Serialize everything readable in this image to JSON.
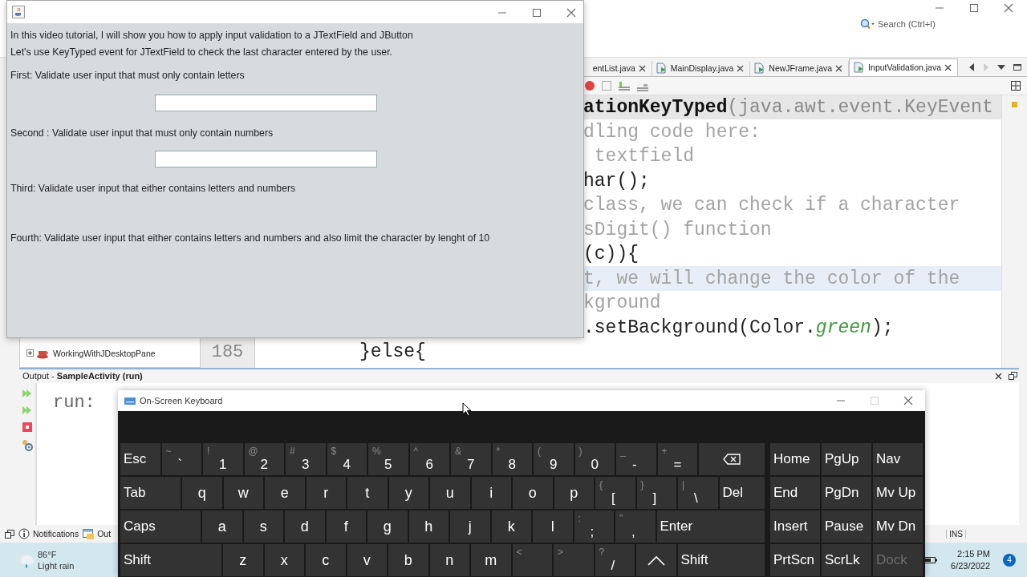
{
  "ide": {
    "search": {
      "placeholder": "Search (Ctrl+I)"
    },
    "editor_tabs": [
      {
        "label": "entList.java",
        "kind": "partial",
        "selected": false
      },
      {
        "label": "MainDisplay.java",
        "kind": "file",
        "selected": false
      },
      {
        "label": "NewJFrame.java",
        "kind": "file",
        "selected": false
      },
      {
        "label": "InputValidation.java",
        "kind": "file",
        "selected": true
      }
    ],
    "code_lines": [
      {
        "kind": "cut",
        "color": "#e6e6e6",
        "segments": [
          {
            "kind": "method",
            "text": "ationKeyTyped"
          },
          {
            "kind": "parameter",
            "text": "(java.awt.event.KeyEvent"
          }
        ]
      },
      {
        "kind": "cut",
        "segments": [
          {
            "kind": "comment",
            "text": "dling code here:"
          }
        ]
      },
      {
        "kind": "cut",
        "segments": [
          {
            "kind": "comment",
            "text": " textfield"
          }
        ]
      },
      {
        "kind": "cut",
        "segments": [
          {
            "kind": "code",
            "text": "har();"
          }
        ]
      },
      {
        "kind": "cut",
        "segments": [
          {
            "kind": "comment",
            "text": "class, we can check if a character"
          }
        ]
      },
      {
        "kind": "cut",
        "segments": [
          {
            "kind": "comment",
            "text": "sDigit() function"
          }
        ]
      },
      {
        "kind": "cut",
        "segments": [
          {
            "kind": "code",
            "text": "(c)){"
          }
        ]
      },
      {
        "kind": "cut",
        "color": "#e8eef8",
        "segments": [
          {
            "kind": "comment",
            "text": "t, we will change the color of the"
          }
        ]
      },
      {
        "kind": "cut",
        "segments": [
          {
            "kind": "comment",
            "text": "kground"
          }
        ]
      },
      {
        "kind": "cut",
        "segments": [
          {
            "kind": "code",
            "text": ".setBackground(Color."
          },
          {
            "kind": "field",
            "text": "green"
          },
          {
            "kind": "code",
            "text": ");"
          }
        ]
      },
      {
        "kind": "whole",
        "number": "185",
        "segments": [
          {
            "kind": "code",
            "text": "}else{"
          }
        ]
      }
    ],
    "project_tree": [
      {
        "label": "WorkingWithJDesktopPane",
        "expanded": false
      }
    ],
    "output": {
      "title": "Output - **SampleActivity (run)**",
      "text": "run:"
    },
    "status_bar": {
      "items": [
        {
          "label": "Notifications",
          "kind": "info"
        },
        {
          "label": "Out",
          "kind": "output"
        }
      ],
      "mode": "INS"
    }
  },
  "java_window": {
    "lines": [
      {
        "kind": "text",
        "text": "In this video tutorial, I will show you how to apply input validation to a JTextField and JButton"
      },
      {
        "kind": "text",
        "text": "Let's use KeyTyped event for JTextField to check the last character entered by the user."
      },
      {
        "kind": "text",
        "text": "First: Validate user input that must only contain letters"
      },
      {
        "kind": "field"
      },
      {
        "kind": "text",
        "text": "Second : Validate user input that must only contain numbers"
      },
      {
        "kind": "field"
      },
      {
        "kind": "text",
        "text": "Third: Validate user input that either contains letters and numbers"
      },
      {
        "kind": "text",
        "text": "Fourth: Validate user input that either contains letters and numbers and also limit the character by lenght of 10"
      }
    ]
  },
  "keyboard": {
    "title": "On-Screen Keyboard",
    "controls": [
      {
        "kind": "minimize",
        "disabled": false
      },
      {
        "kind": "maximize",
        "disabled": true
      },
      {
        "kind": "close",
        "disabled": false
      }
    ],
    "rows": [
      {
        "keys": [
          {
            "kind": "fn",
            "label": "Esc"
          },
          {
            "kind": "dual",
            "upper": "~",
            "label": "`"
          },
          {
            "kind": "dual",
            "upper": "!",
            "label": "1"
          },
          {
            "kind": "dual",
            "upper": "@",
            "label": "2"
          },
          {
            "kind": "dual",
            "upper": "#",
            "label": "3"
          },
          {
            "kind": "dual",
            "upper": "$",
            "label": "4"
          },
          {
            "kind": "dual",
            "upper": "%",
            "label": "5"
          },
          {
            "kind": "dual",
            "upper": "^",
            "label": "6"
          },
          {
            "kind": "dual",
            "upper": "&",
            "label": "7"
          },
          {
            "kind": "dual",
            "upper": "*",
            "label": "8"
          },
          {
            "kind": "dual",
            "upper": "(",
            "label": "9"
          },
          {
            "kind": "dual",
            "upper": ")",
            "label": "0"
          },
          {
            "kind": "dual",
            "upper": "_",
            "label": "-"
          },
          {
            "kind": "dual",
            "upper": "+",
            "label": "="
          },
          {
            "kind": "backspace"
          }
        ]
      },
      {
        "keys": [
          {
            "kind": "tab",
            "label": "Tab"
          },
          {
            "kind": "letter",
            "label": "q"
          },
          {
            "kind": "letter",
            "label": "w"
          },
          {
            "kind": "letter",
            "label": "e"
          },
          {
            "kind": "letter",
            "label": "r"
          },
          {
            "kind": "letter",
            "label": "t"
          },
          {
            "kind": "letter",
            "label": "y"
          },
          {
            "kind": "letter",
            "label": "u"
          },
          {
            "kind": "letter",
            "label": "i"
          },
          {
            "kind": "letter",
            "label": "o"
          },
          {
            "kind": "letter",
            "label": "p"
          },
          {
            "kind": "dual",
            "upper": "{",
            "label": "["
          },
          {
            "kind": "dual",
            "upper": "}",
            "label": "]"
          },
          {
            "kind": "dual",
            "upper": "|",
            "label": "\\"
          },
          {
            "kind": "end",
            "label": "Del"
          }
        ]
      },
      {
        "keys": [
          {
            "kind": "caps",
            "label": "Caps"
          },
          {
            "kind": "letter",
            "label": "a"
          },
          {
            "kind": "letter",
            "label": "s"
          },
          {
            "kind": "letter",
            "label": "d"
          },
          {
            "kind": "letter",
            "label": "f"
          },
          {
            "kind": "letter",
            "label": "g"
          },
          {
            "kind": "letter",
            "label": "h"
          },
          {
            "kind": "letter",
            "label": "j"
          },
          {
            "kind": "letter",
            "label": "k"
          },
          {
            "kind": "letter",
            "label": "l"
          },
          {
            "kind": "dual",
            "upper": ":",
            "label": ";"
          },
          {
            "kind": "dual",
            "upper": "\"",
            "label": ","
          },
          {
            "kind": "end",
            "label": "Enter"
          }
        ]
      },
      {
        "keys": [
          {
            "kind": "shift",
            "label": "Shift"
          },
          {
            "kind": "letter",
            "label": "z"
          },
          {
            "kind": "letter",
            "label": "x"
          },
          {
            "kind": "letter",
            "label": "c"
          },
          {
            "kind": "letter",
            "label": "v"
          },
          {
            "kind": "letter",
            "label": "b"
          },
          {
            "kind": "letter",
            "label": "n"
          },
          {
            "kind": "letter",
            "label": "m"
          },
          {
            "kind": "dual",
            "upper": "<"
          },
          {
            "kind": "dual",
            "upper": ">"
          },
          {
            "kind": "dual",
            "upper": "?",
            "label": "/"
          },
          {
            "kind": "up"
          },
          {
            "kind": "end",
            "label": "Shift"
          }
        ]
      }
    ],
    "nav_keys": [
      {
        "label": "Home",
        "disabled": false
      },
      {
        "label": "PgUp",
        "disabled": false
      },
      {
        "label": "Nav",
        "disabled": false
      },
      {
        "label": "End",
        "disabled": false
      },
      {
        "label": "PgDn",
        "disabled": false
      },
      {
        "label": "Mv Up",
        "disabled": false
      },
      {
        "label": "Insert",
        "disabled": false
      },
      {
        "label": "Pause",
        "disabled": false
      },
      {
        "label": "Mv Dn",
        "disabled": false
      },
      {
        "label": "PrtScn",
        "disabled": false
      },
      {
        "label": "ScrLk",
        "disabled": false
      },
      {
        "label": "Dock",
        "disabled": true
      }
    ]
  },
  "taskbar": {
    "weather": {
      "temperature": "86°F",
      "condition": "Light rain"
    },
    "time": "2:15 PM",
    "date": "6/23/2022",
    "notification_count": "4"
  }
}
